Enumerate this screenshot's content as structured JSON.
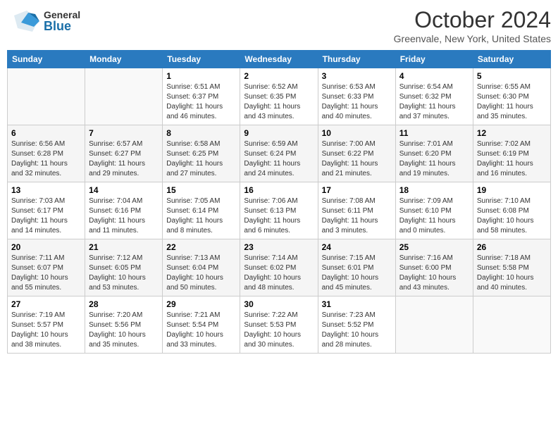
{
  "header": {
    "logo_general": "General",
    "logo_blue": "Blue",
    "title": "October 2024",
    "location": "Greenvale, New York, United States"
  },
  "weekdays": [
    "Sunday",
    "Monday",
    "Tuesday",
    "Wednesday",
    "Thursday",
    "Friday",
    "Saturday"
  ],
  "weeks": [
    [
      {
        "day": "",
        "info": ""
      },
      {
        "day": "",
        "info": ""
      },
      {
        "day": "1",
        "info": "Sunrise: 6:51 AM\nSunset: 6:37 PM\nDaylight: 11 hours and 46 minutes."
      },
      {
        "day": "2",
        "info": "Sunrise: 6:52 AM\nSunset: 6:35 PM\nDaylight: 11 hours and 43 minutes."
      },
      {
        "day": "3",
        "info": "Sunrise: 6:53 AM\nSunset: 6:33 PM\nDaylight: 11 hours and 40 minutes."
      },
      {
        "day": "4",
        "info": "Sunrise: 6:54 AM\nSunset: 6:32 PM\nDaylight: 11 hours and 37 minutes."
      },
      {
        "day": "5",
        "info": "Sunrise: 6:55 AM\nSunset: 6:30 PM\nDaylight: 11 hours and 35 minutes."
      }
    ],
    [
      {
        "day": "6",
        "info": "Sunrise: 6:56 AM\nSunset: 6:28 PM\nDaylight: 11 hours and 32 minutes."
      },
      {
        "day": "7",
        "info": "Sunrise: 6:57 AM\nSunset: 6:27 PM\nDaylight: 11 hours and 29 minutes."
      },
      {
        "day": "8",
        "info": "Sunrise: 6:58 AM\nSunset: 6:25 PM\nDaylight: 11 hours and 27 minutes."
      },
      {
        "day": "9",
        "info": "Sunrise: 6:59 AM\nSunset: 6:24 PM\nDaylight: 11 hours and 24 minutes."
      },
      {
        "day": "10",
        "info": "Sunrise: 7:00 AM\nSunset: 6:22 PM\nDaylight: 11 hours and 21 minutes."
      },
      {
        "day": "11",
        "info": "Sunrise: 7:01 AM\nSunset: 6:20 PM\nDaylight: 11 hours and 19 minutes."
      },
      {
        "day": "12",
        "info": "Sunrise: 7:02 AM\nSunset: 6:19 PM\nDaylight: 11 hours and 16 minutes."
      }
    ],
    [
      {
        "day": "13",
        "info": "Sunrise: 7:03 AM\nSunset: 6:17 PM\nDaylight: 11 hours and 14 minutes."
      },
      {
        "day": "14",
        "info": "Sunrise: 7:04 AM\nSunset: 6:16 PM\nDaylight: 11 hours and 11 minutes."
      },
      {
        "day": "15",
        "info": "Sunrise: 7:05 AM\nSunset: 6:14 PM\nDaylight: 11 hours and 8 minutes."
      },
      {
        "day": "16",
        "info": "Sunrise: 7:06 AM\nSunset: 6:13 PM\nDaylight: 11 hours and 6 minutes."
      },
      {
        "day": "17",
        "info": "Sunrise: 7:08 AM\nSunset: 6:11 PM\nDaylight: 11 hours and 3 minutes."
      },
      {
        "day": "18",
        "info": "Sunrise: 7:09 AM\nSunset: 6:10 PM\nDaylight: 11 hours and 0 minutes."
      },
      {
        "day": "19",
        "info": "Sunrise: 7:10 AM\nSunset: 6:08 PM\nDaylight: 10 hours and 58 minutes."
      }
    ],
    [
      {
        "day": "20",
        "info": "Sunrise: 7:11 AM\nSunset: 6:07 PM\nDaylight: 10 hours and 55 minutes."
      },
      {
        "day": "21",
        "info": "Sunrise: 7:12 AM\nSunset: 6:05 PM\nDaylight: 10 hours and 53 minutes."
      },
      {
        "day": "22",
        "info": "Sunrise: 7:13 AM\nSunset: 6:04 PM\nDaylight: 10 hours and 50 minutes."
      },
      {
        "day": "23",
        "info": "Sunrise: 7:14 AM\nSunset: 6:02 PM\nDaylight: 10 hours and 48 minutes."
      },
      {
        "day": "24",
        "info": "Sunrise: 7:15 AM\nSunset: 6:01 PM\nDaylight: 10 hours and 45 minutes."
      },
      {
        "day": "25",
        "info": "Sunrise: 7:16 AM\nSunset: 6:00 PM\nDaylight: 10 hours and 43 minutes."
      },
      {
        "day": "26",
        "info": "Sunrise: 7:18 AM\nSunset: 5:58 PM\nDaylight: 10 hours and 40 minutes."
      }
    ],
    [
      {
        "day": "27",
        "info": "Sunrise: 7:19 AM\nSunset: 5:57 PM\nDaylight: 10 hours and 38 minutes."
      },
      {
        "day": "28",
        "info": "Sunrise: 7:20 AM\nSunset: 5:56 PM\nDaylight: 10 hours and 35 minutes."
      },
      {
        "day": "29",
        "info": "Sunrise: 7:21 AM\nSunset: 5:54 PM\nDaylight: 10 hours and 33 minutes."
      },
      {
        "day": "30",
        "info": "Sunrise: 7:22 AM\nSunset: 5:53 PM\nDaylight: 10 hours and 30 minutes."
      },
      {
        "day": "31",
        "info": "Sunrise: 7:23 AM\nSunset: 5:52 PM\nDaylight: 10 hours and 28 minutes."
      },
      {
        "day": "",
        "info": ""
      },
      {
        "day": "",
        "info": ""
      }
    ]
  ]
}
